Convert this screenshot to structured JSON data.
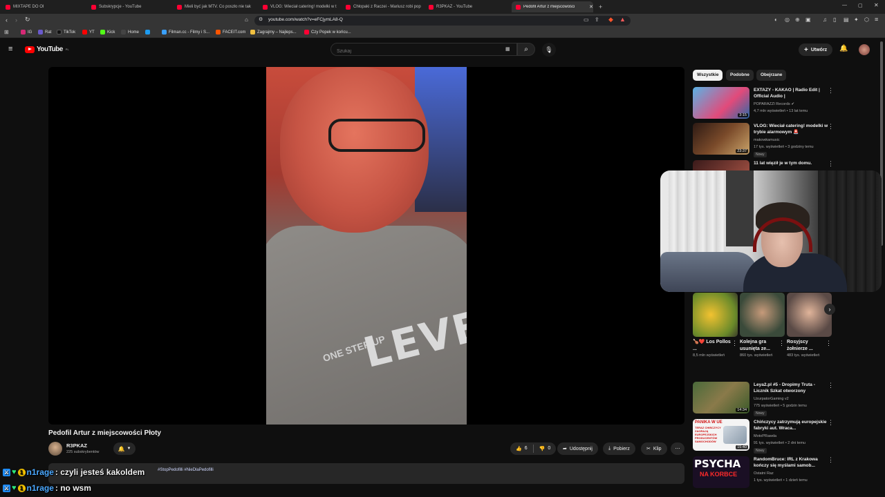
{
  "browser": {
    "tabs": [
      {
        "label": "MIXTAPE DO OI"
      },
      {
        "label": "Subskrypcje - YouTube"
      },
      {
        "label": "Mieli być jak MTV. Co poszło nie tak"
      },
      {
        "label": "VLOG: Wieciał catering! modelki w t"
      },
      {
        "label": "Chłopaki z Raczei - Mariusz robi pop"
      },
      {
        "label": "R3PKAZ - YouTube"
      },
      {
        "label": "Pedofil Artur z miejscowości",
        "close": "✕"
      }
    ],
    "new_tab": "+",
    "url": "youtube.com/watch?v=eFCjymLA8-Q",
    "bookmarks": [
      {
        "label": "IG",
        "color": "#d62976"
      },
      {
        "label": "Rat",
        "color": "#6a5acd"
      },
      {
        "label": "TikTok",
        "color": "#000000"
      },
      {
        "label": "YT",
        "color": "#ff0000"
      },
      {
        "label": "Kick",
        "color": "#53fc18"
      },
      {
        "label": "Home",
        "color": "#444444"
      },
      {
        "label": "",
        "color": "#1d9bf0"
      },
      {
        "label": "Filman.cc - Filmy i S...",
        "color": "#3aa0ff"
      },
      {
        "label": "FACEIT.com",
        "color": "#ff5500"
      },
      {
        "label": "Zagrajmy – Najleps...",
        "color": "#f0c040"
      },
      {
        "label": "Czy Popek w końcu...",
        "color": "#ff0033"
      }
    ]
  },
  "youtube": {
    "logo_text": "YouTube",
    "logo_region": "PL",
    "search_placeholder": "Szukaj",
    "create_label": "Utwórz"
  },
  "video": {
    "title": "Pedofil Artur z miejscowości Płoty",
    "channel": "R3PKAZ",
    "subscribers": "225 subskrybentów",
    "likes": "6",
    "dislikes": "0",
    "share_label": "Udostępnij",
    "download_label": "Pobierz",
    "clip_label": "Klip",
    "description_tags": "#StopPedofilli #NieDlaPedofilli"
  },
  "sidebar": {
    "chips": [
      "Wszystkie",
      "Podobne",
      "Obejrzane"
    ],
    "recs_top": [
      {
        "title": "EXTAZY - KAKAO | Radio Edit | Official Audio |",
        "channel": "POPARAZZI Records",
        "meta": "4,7 mln wyświetleń • 13 lat temu",
        "duration": "3:15",
        "badge": ""
      },
      {
        "title": "VLOG: Wieciał catering! modelki w trybie alarmowym 🚨",
        "channel": "makowkamusic",
        "meta": "17 tys. wyświetleń • 3 godziny temu",
        "duration": "23:37",
        "badge": "Nowy"
      },
      {
        "title": "11 lat więził je w tym domu.",
        "channel": "",
        "meta": "",
        "duration": "",
        "badge": ""
      }
    ],
    "shorts": [
      {
        "title": "🍗❤️ Los Pollos ...",
        "views": "8,5 mln wyświetleń"
      },
      {
        "title": "Kolejna gra usunięta ze...",
        "views": "860 tys. wyświetleń"
      },
      {
        "title": "Rosyjscy żołnierze ...",
        "views": "483 tys. wyświetleń"
      }
    ],
    "recs_bottom": [
      {
        "title": "Leya2.pl #5 - Dropimy Truta - Licznik Szkat otworzony",
        "channel": "UzurpatorGaming v2",
        "meta": "775 wyświetleń • 5 godzin temu",
        "duration": "14:34",
        "badge": "Nowy"
      },
      {
        "title": "Chińczycy zatrzymują europejskie fabryki aut. Wraca...",
        "channel": "MotoPRawda",
        "meta": "91 tys. wyświetleń • 2 dni temu",
        "duration": "15:40",
        "badge": "Nowy"
      },
      {
        "title": "RandomBruce: IRL z Krakowa kończy się myślami samob...",
        "channel": "Ostatni Raz",
        "meta": "1 tys. wyświetleń • 1 dzień temu",
        "duration": "",
        "badge": ""
      }
    ],
    "thumb_text_1": "PANIKA W UE",
    "thumb_text_2": "TERAZ CHIŃCZYCY ZAORAJĄ EUROPEJSKICH PRODUCENTÓW SAMOCHODÓW",
    "thumb_text_3": "PSYCHA",
    "thumb_text_4": "NA KORBCE"
  },
  "chat": [
    {
      "user": "n1rage",
      "message": ": czyli jesteś kakoldem"
    },
    {
      "user": "n1rage",
      "message": ": no wsm"
    }
  ],
  "colors": {
    "accent": "#ff0000",
    "bg": "#0f0f0f",
    "chip_bg": "#272727"
  }
}
